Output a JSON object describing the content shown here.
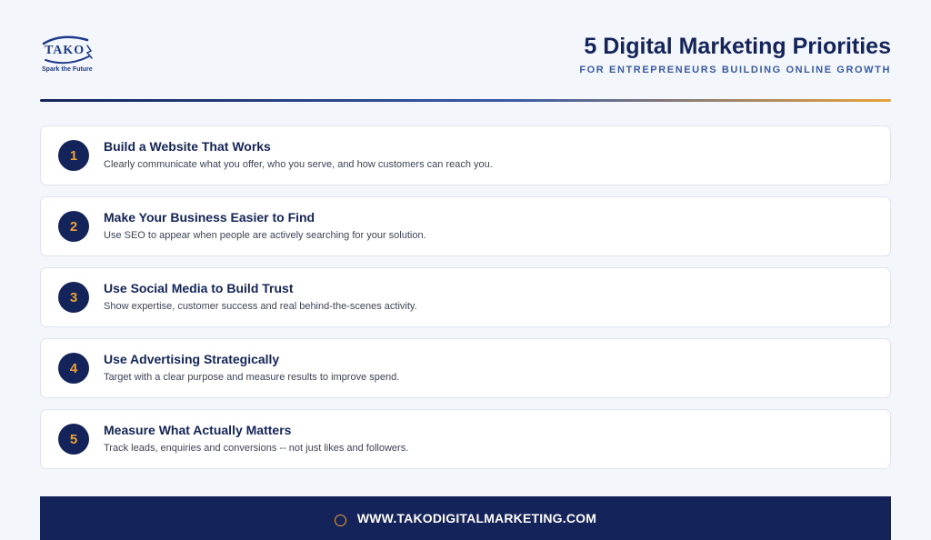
{
  "logo": {
    "name": "TAKO",
    "tagline": "Spark the Future"
  },
  "header": {
    "title": "5 Digital Marketing Priorities",
    "subtitle": "FOR ENTREPRENEURS BUILDING ONLINE GROWTH"
  },
  "priorities": [
    {
      "number": "1",
      "title": "Build a Website That Works",
      "description": "Clearly communicate what you offer, who you serve, and how customers can reach you."
    },
    {
      "number": "2",
      "title": "Make Your Business Easier to Find",
      "description": "Use SEO to appear when people are actively searching for your solution."
    },
    {
      "number": "3",
      "title": "Use Social Media to Build Trust",
      "description": "Show expertise, customer success and real behind-the-scenes activity."
    },
    {
      "number": "4",
      "title": "Use Advertising Strategically",
      "description": "Target with a clear purpose and measure results to improve spend."
    },
    {
      "number": "5",
      "title": "Measure What Actually Matters",
      "description": "Track leads, enquiries and conversions -- not just likes and followers."
    }
  ],
  "footer": {
    "icon": "globe-icon",
    "url": "WWW.TAKODIGITALMARKETING.COM"
  },
  "colors": {
    "navy": "#14245a",
    "accent": "#e8a33b",
    "blue": "#3b5aa6"
  }
}
